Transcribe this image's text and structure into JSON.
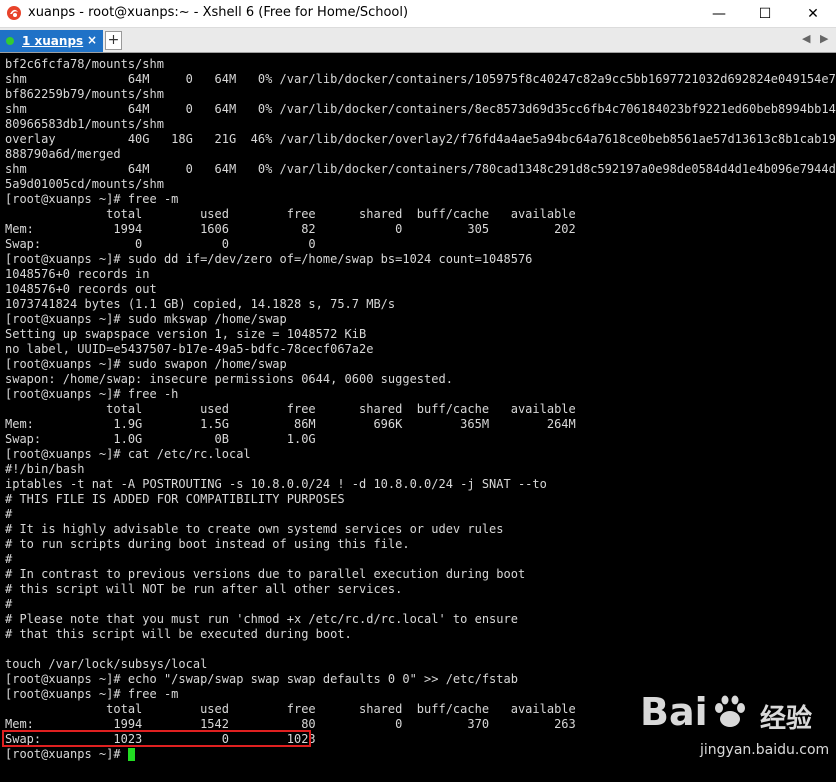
{
  "window": {
    "title": "xuanps - root@xuanps:~ - Xshell 6 (Free for Home/School)",
    "min_glyph": "—",
    "max_glyph": "☐",
    "close_glyph": "✕",
    "app_icon": "xshell-swirl-icon"
  },
  "tabs": [
    {
      "label": "1 xuanps",
      "close_glyph": "×",
      "status_color": "#33cc33",
      "active_color": "#1f72c7"
    }
  ],
  "tabbar": {
    "add_glyph": "+",
    "nav_left": "◀",
    "nav_right": "▶"
  },
  "terminal": {
    "lines": [
      "bf2c6fcfa78/mounts/shm",
      "shm              64M     0   64M   0% /var/lib/docker/containers/105975f8c40247c82a9cc5bb1697721032d692824e049154e733f",
      "bf862259b79/mounts/shm",
      "shm              64M     0   64M   0% /var/lib/docker/containers/8ec8573d69d35cc6fb4c706184023bf9221ed60beb8994bb1441b",
      "80966583db1/mounts/shm",
      "overlay          40G   18G   21G  46% /var/lib/docker/overlay2/f76fd4a4ae5a94bc64a7618ce0beb8561ae57d13613c8b1cab196d8",
      "888790a6d/merged",
      "shm              64M     0   64M   0% /var/lib/docker/containers/780cad1348c291d8c592197a0e98de0584d4d1e4b096e7944d288",
      "5a9d01005cd/mounts/shm",
      "[root@xuanps ~]# free -m",
      "              total        used        free      shared  buff/cache   available",
      "Mem:           1994        1606          82           0         305         202",
      "Swap:             0           0           0",
      "[root@xuanps ~]# sudo dd if=/dev/zero of=/home/swap bs=1024 count=1048576",
      "1048576+0 records in",
      "1048576+0 records out",
      "1073741824 bytes (1.1 GB) copied, 14.1828 s, 75.7 MB/s",
      "[root@xuanps ~]# sudo mkswap /home/swap",
      "Setting up swapspace version 1, size = 1048572 KiB",
      "no label, UUID=e5437507-b17e-49a5-bdfc-78cecf067a2e",
      "[root@xuanps ~]# sudo swapon /home/swap",
      "swapon: /home/swap: insecure permissions 0644, 0600 suggested.",
      "[root@xuanps ~]# free -h",
      "              total        used        free      shared  buff/cache   available",
      "Mem:           1.9G        1.5G         86M        696K        365M        264M",
      "Swap:          1.0G          0B        1.0G",
      "[root@xuanps ~]# cat /etc/rc.local",
      "#!/bin/bash",
      "iptables -t nat -A POSTROUTING -s 10.8.0.0/24 ! -d 10.8.0.0/24 -j SNAT --to",
      "# THIS FILE IS ADDED FOR COMPATIBILITY PURPOSES",
      "#",
      "# It is highly advisable to create own systemd services or udev rules",
      "# to run scripts during boot instead of using this file.",
      "#",
      "# In contrast to previous versions due to parallel execution during boot",
      "# this script will NOT be run after all other services.",
      "#",
      "# Please note that you must run 'chmod +x /etc/rc.d/rc.local' to ensure",
      "# that this script will be executed during boot.",
      "",
      "touch /var/lock/subsys/local",
      "[root@xuanps ~]# echo \"/swap/swap swap swap defaults 0 0\" >> /etc/fstab",
      "[root@xuanps ~]# free -m",
      "              total        used        free      shared  buff/cache   available",
      "Mem:           1994        1542          80           0         370         263",
      "Swap:          1023           0        1023",
      "[root@xuanps ~]# "
    ],
    "text_color": "#d8d8d8",
    "cursor_color": "#22dd22",
    "highlight_color": "#e02020"
  },
  "watermark": {
    "logo_left": "Bai",
    "logo_right": "经验",
    "url": "jingyan.baidu.com"
  }
}
